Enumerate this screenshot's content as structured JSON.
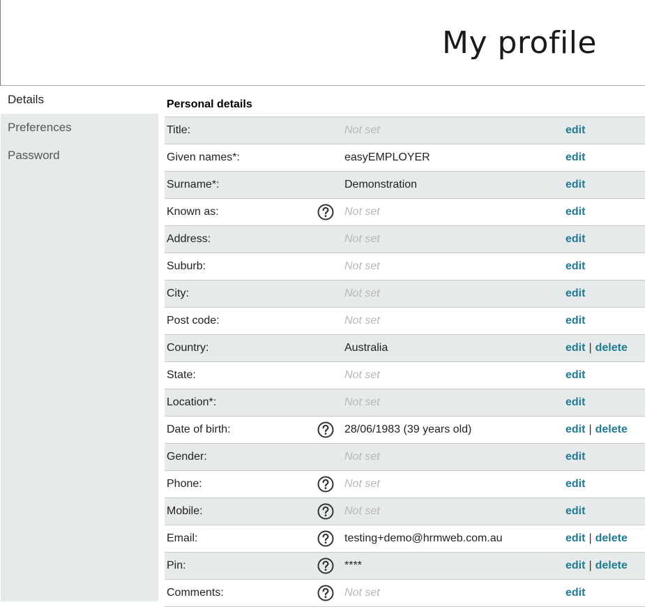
{
  "page": {
    "title": "My profile"
  },
  "sidebar": {
    "items": [
      {
        "label": "Details",
        "active": true
      },
      {
        "label": "Preferences",
        "active": false
      },
      {
        "label": "Password",
        "active": false
      }
    ]
  },
  "section": {
    "title": "Personal details"
  },
  "actions": {
    "edit_label": "edit",
    "delete_label": "delete",
    "separator": "|"
  },
  "rows": [
    {
      "label": "Title:",
      "value": "Not set",
      "empty": true,
      "help": false,
      "delete": false
    },
    {
      "label": "Given names*:",
      "value": "easyEMPLOYER",
      "empty": false,
      "help": false,
      "delete": false
    },
    {
      "label": "Surname*:",
      "value": "Demonstration",
      "empty": false,
      "help": false,
      "delete": false
    },
    {
      "label": "Known as:",
      "value": "Not set",
      "empty": true,
      "help": true,
      "delete": false
    },
    {
      "label": "Address:",
      "value": "Not set",
      "empty": true,
      "help": false,
      "delete": false
    },
    {
      "label": "Suburb:",
      "value": "Not set",
      "empty": true,
      "help": false,
      "delete": false
    },
    {
      "label": "City:",
      "value": "Not set",
      "empty": true,
      "help": false,
      "delete": false
    },
    {
      "label": "Post code:",
      "value": "Not set",
      "empty": true,
      "help": false,
      "delete": false
    },
    {
      "label": "Country:",
      "value": "Australia",
      "empty": false,
      "help": false,
      "delete": true
    },
    {
      "label": "State:",
      "value": "Not set",
      "empty": true,
      "help": false,
      "delete": false
    },
    {
      "label": "Location*:",
      "value": "Not set",
      "empty": true,
      "help": false,
      "delete": false
    },
    {
      "label": "Date of birth:",
      "value": "28/06/1983 (39 years old)",
      "empty": false,
      "help": true,
      "delete": true
    },
    {
      "label": "Gender:",
      "value": "Not set",
      "empty": true,
      "help": false,
      "delete": false
    },
    {
      "label": "Phone:",
      "value": "Not set",
      "empty": true,
      "help": true,
      "delete": false
    },
    {
      "label": "Mobile:",
      "value": "Not set",
      "empty": true,
      "help": true,
      "delete": false
    },
    {
      "label": "Email:",
      "value": "testing+demo@hrmweb.com.au",
      "empty": false,
      "help": true,
      "delete": true
    },
    {
      "label": "Pin:",
      "value": "****",
      "empty": false,
      "help": true,
      "delete": true
    },
    {
      "label": "Comments:",
      "value": "Not set",
      "empty": true,
      "help": true,
      "delete": false
    }
  ],
  "colors": {
    "accent": "#1f7a92",
    "shade": "#e7eaeb",
    "placeholder": "#b7b7b7"
  },
  "icons": {
    "help": "question-circle-icon"
  }
}
